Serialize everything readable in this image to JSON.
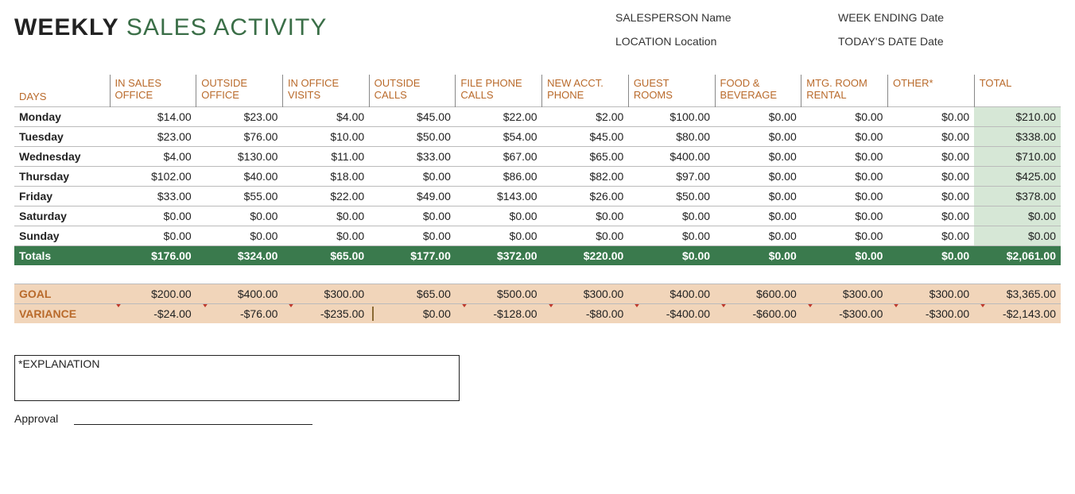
{
  "title_bold": "WEEKLY",
  "title_rest": " SALES ACTIVITY",
  "meta": {
    "sp_label": "SALESPERSON",
    "sp_value": "Name",
    "week_label": "WEEK ENDING",
    "week_value": "Date",
    "loc_label": "LOCATION",
    "loc_value": "Location",
    "today_label": "TODAY'S DATE",
    "today_value": "Date"
  },
  "columns": {
    "days": "DAYS",
    "c1": "IN SALES OFFICE",
    "c2": "OUTSIDE OFFICE",
    "c3": "IN OFFICE VISITS",
    "c4": "OUTSIDE CALLS",
    "c5": "FILE PHONE CALLS",
    "c6": "NEW ACCT. PHONE",
    "c7": "GUEST ROOMS",
    "c8": "FOOD & BEVERAGE",
    "c9": "MTG. ROOM RENTAL",
    "c10": "OTHER*",
    "c11": "TOTAL"
  },
  "rows": [
    {
      "day": "Monday",
      "v": [
        "$14.00",
        "$23.00",
        "$4.00",
        "$45.00",
        "$22.00",
        "$2.00",
        "$100.00",
        "$0.00",
        "$0.00",
        "$0.00",
        "$210.00"
      ]
    },
    {
      "day": "Tuesday",
      "v": [
        "$23.00",
        "$76.00",
        "$10.00",
        "$50.00",
        "$54.00",
        "$45.00",
        "$80.00",
        "$0.00",
        "$0.00",
        "$0.00",
        "$338.00"
      ]
    },
    {
      "day": "Wednesday",
      "v": [
        "$4.00",
        "$130.00",
        "$11.00",
        "$33.00",
        "$67.00",
        "$65.00",
        "$400.00",
        "$0.00",
        "$0.00",
        "$0.00",
        "$710.00"
      ]
    },
    {
      "day": "Thursday",
      "v": [
        "$102.00",
        "$40.00",
        "$18.00",
        "$0.00",
        "$86.00",
        "$82.00",
        "$97.00",
        "$0.00",
        "$0.00",
        "$0.00",
        "$425.00"
      ]
    },
    {
      "day": "Friday",
      "v": [
        "$33.00",
        "$55.00",
        "$22.00",
        "$49.00",
        "$143.00",
        "$26.00",
        "$50.00",
        "$0.00",
        "$0.00",
        "$0.00",
        "$378.00"
      ]
    },
    {
      "day": "Saturday",
      "v": [
        "$0.00",
        "$0.00",
        "$0.00",
        "$0.00",
        "$0.00",
        "$0.00",
        "$0.00",
        "$0.00",
        "$0.00",
        "$0.00",
        "$0.00"
      ]
    },
    {
      "day": "Sunday",
      "v": [
        "$0.00",
        "$0.00",
        "$0.00",
        "$0.00",
        "$0.00",
        "$0.00",
        "$0.00",
        "$0.00",
        "$0.00",
        "$0.00",
        "$0.00"
      ]
    }
  ],
  "totals": {
    "label": "Totals",
    "v": [
      "$176.00",
      "$324.00",
      "$65.00",
      "$177.00",
      "$372.00",
      "$220.00",
      "$0.00",
      "$0.00",
      "$0.00",
      "$0.00",
      "$2,061.00"
    ]
  },
  "goal": {
    "label": "GOAL",
    "v": [
      "$200.00",
      "$400.00",
      "$300.00",
      "$65.00",
      "$500.00",
      "$300.00",
      "$400.00",
      "$600.00",
      "$300.00",
      "$300.00",
      "$3,365.00"
    ]
  },
  "variance": {
    "label": "VARIANCE",
    "v": [
      "-$24.00",
      "-$76.00",
      "-$235.00",
      "$0.00",
      "-$128.00",
      "-$80.00",
      "-$400.00",
      "-$600.00",
      "-$300.00",
      "-$300.00",
      "-$2,143.00"
    ],
    "ind": [
      "down",
      "down",
      "down",
      "flat",
      "down",
      "down",
      "down",
      "down",
      "down",
      "down",
      "down"
    ]
  },
  "explanation_label": "*EXPLANATION",
  "approval_label": "Approval"
}
